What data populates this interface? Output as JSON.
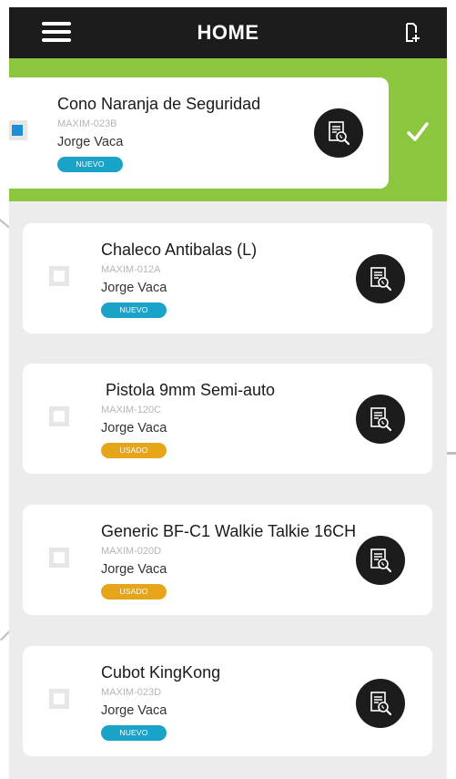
{
  "header": {
    "title": "HOME",
    "menu_icon": "hamburger-menu-icon",
    "add_icon": "add-device-icon"
  },
  "colors": {
    "topbar": "#1c1c1c",
    "swipe_action": "#8cc63f",
    "badge_nuevo": "#1aa3c8",
    "badge_usado": "#e7a51a",
    "checkbox_checked": "#1b8fd6",
    "background": "#ececed"
  },
  "items": [
    {
      "name": "Cono Naranja de Seguridad",
      "code": "MAXIM-023B",
      "owner": "Jorge Vaca",
      "status": "NUEVO",
      "status_color": "#1aa3c8",
      "selected": true
    },
    {
      "name": "Chaleco Antibalas (L)",
      "code": "MAXIM-012A",
      "owner": "Jorge Vaca",
      "status": "NUEVO",
      "status_color": "#1aa3c8",
      "selected": false
    },
    {
      "name": " Pistola 9mm Semi-auto",
      "code": "MAXIM-120C",
      "owner": "Jorge Vaca",
      "status": "USADO",
      "status_color": "#e7a51a",
      "selected": false
    },
    {
      "name": "Generic BF-C1 Walkie Talkie 16CH",
      "code": "MAXIM-020D",
      "owner": "Jorge Vaca",
      "status": "USADO",
      "status_color": "#e7a51a",
      "selected": false
    },
    {
      "name": "Cubot KingKong",
      "code": "MAXIM-023D",
      "owner": "Jorge Vaca",
      "status": "NUEVO",
      "status_color": "#1aa3c8",
      "selected": false
    }
  ]
}
